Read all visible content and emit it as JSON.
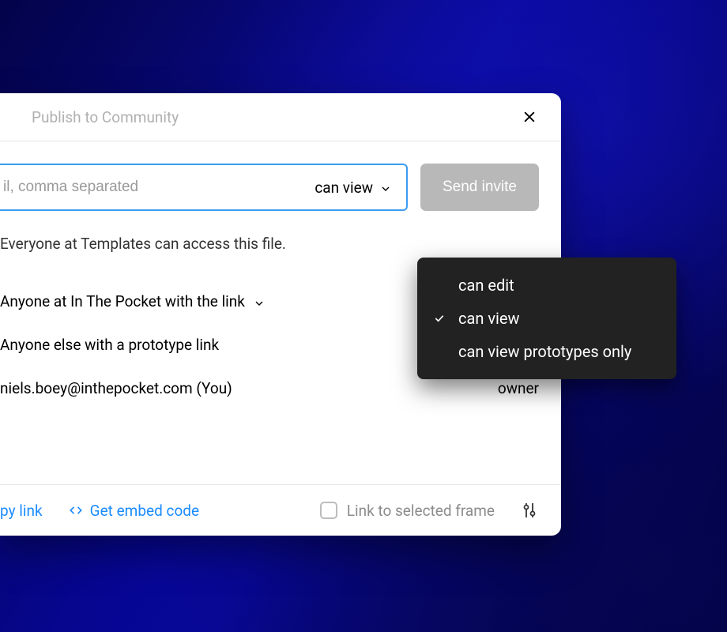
{
  "header": {
    "title": "Publish to Community"
  },
  "invite": {
    "placeholder": "il, comma separated",
    "permission_label": "can view",
    "send_button_label": "Send invite"
  },
  "access_info": "Everyone at Templates can access this file.",
  "share_rows": [
    {
      "label": "Anyone at In The Pocket with the link",
      "has_chevron": true,
      "right": ""
    },
    {
      "label": "Anyone else with a prototype link",
      "has_chevron": false,
      "right": ""
    },
    {
      "label": "niels.boey@inthepocket.com (You)",
      "has_chevron": false,
      "right": "owner"
    }
  ],
  "footer": {
    "copy_link_label": "py link",
    "embed_label": "Get embed code",
    "checkbox_label": "Link to selected frame"
  },
  "dropdown": {
    "options": [
      {
        "label": "can edit",
        "selected": false
      },
      {
        "label": "can view",
        "selected": true
      },
      {
        "label": "can view prototypes only",
        "selected": false
      }
    ]
  }
}
